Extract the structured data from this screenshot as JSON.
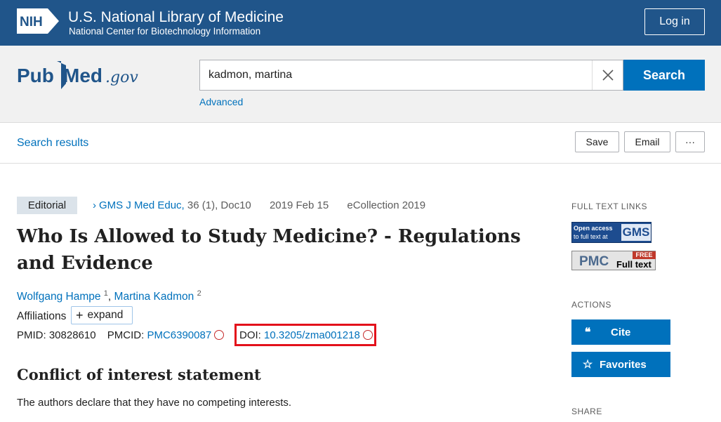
{
  "header": {
    "logo_text": "NIH",
    "org_title": "U.S. National Library of Medicine",
    "org_subtitle": "National Center for Biotechnology Information",
    "login_label": "Log in"
  },
  "search": {
    "query": "kadmon, martina",
    "button_label": "Search",
    "advanced_label": "Advanced",
    "logo_left": "Pub",
    "logo_right": "Med",
    "logo_suffix": ".gov"
  },
  "results_bar": {
    "link_label": "Search results",
    "save_label": "Save",
    "email_label": "Email",
    "more_label": "···"
  },
  "article": {
    "pub_type": "Editorial",
    "journal": "GMS J Med Educ,",
    "citation": "36 (1), Doc10",
    "date": "2019 Feb 15",
    "ecollection": "eCollection 2019",
    "title": "Who Is Allowed to Study Medicine? - Regulations and Evidence",
    "authors": [
      {
        "name": "Wolfgang Hampe",
        "sup": "1"
      },
      {
        "name": "Martina Kadmon",
        "sup": "2"
      }
    ],
    "affiliations_label": "Affiliations",
    "expand_label": "expand",
    "pmid_label": "PMID:",
    "pmid": "30828610",
    "pmcid_label": "PMCID:",
    "pmcid": "PMC6390087",
    "doi_label": "DOI:",
    "doi": "10.3205/zma001218",
    "coi_heading": "Conflict of interest statement",
    "coi_text": "The authors declare that they have no competing interests."
  },
  "sidebar": {
    "full_text_label": "FULL TEXT LINKS",
    "gms_line1": "Open access",
    "gms_line2": "to full text at",
    "gms_brand": "GMS",
    "pmc_brand": "PMC",
    "pmc_free": "FREE",
    "pmc_full_text": "Full text",
    "actions_label": "ACTIONS",
    "cite_label": "Cite",
    "favorites_label": "Favorites",
    "share_label": "SHARE"
  },
  "colors": {
    "nih_blue": "#20558a",
    "link_blue": "#0071bc",
    "highlight_red": "#e3111b"
  }
}
